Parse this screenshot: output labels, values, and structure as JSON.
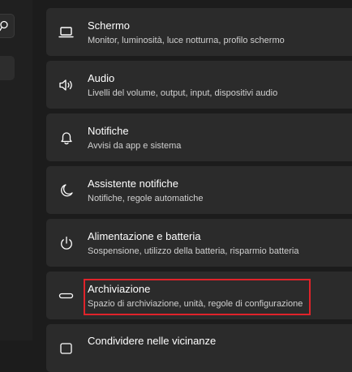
{
  "left_nav": {
    "search_icon": "search-icon"
  },
  "settings": [
    {
      "title": "Schermo",
      "description": "Monitor, luminosità, luce notturna, profilo schermo",
      "icon": "monitor-icon"
    },
    {
      "title": "Audio",
      "description": "Livelli del volume, output, input, dispositivi audio",
      "icon": "speaker-icon"
    },
    {
      "title": "Notifiche",
      "description": "Avvisi da app e sistema",
      "icon": "bell-icon"
    },
    {
      "title": "Assistente notifiche",
      "description": "Notifiche, regole automatiche",
      "icon": "moon-icon"
    },
    {
      "title": "Alimentazione e batteria",
      "description": "Sospensione, utilizzo della batteria, risparmio batteria",
      "icon": "power-icon"
    },
    {
      "title": "Archiviazione",
      "description": "Spazio di archiviazione, unità, regole di configurazione",
      "icon": "storage-drive-icon",
      "highlighted": true
    },
    {
      "title": "Condividere nelle vicinanze",
      "description": "",
      "icon": "share-icon"
    }
  ],
  "colors": {
    "background": "#1c1c1c",
    "card": "#2b2b2b",
    "highlight": "#e0232a"
  }
}
